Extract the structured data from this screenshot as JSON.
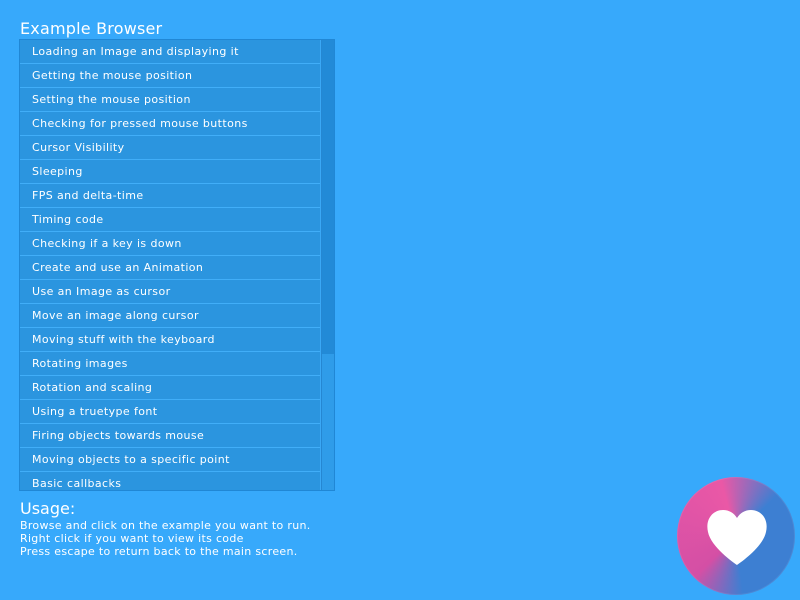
{
  "browser": {
    "title": "Example Browser"
  },
  "examples": [
    {
      "label": "Loading an Image and displaying it"
    },
    {
      "label": "Getting the mouse position"
    },
    {
      "label": "Setting the mouse position"
    },
    {
      "label": "Checking for pressed mouse buttons"
    },
    {
      "label": "Cursor Visibility"
    },
    {
      "label": "Sleeping"
    },
    {
      "label": "FPS and delta-time"
    },
    {
      "label": "Timing code"
    },
    {
      "label": "Checking if a key is down"
    },
    {
      "label": "Create and use an Animation"
    },
    {
      "label": "Use an Image as cursor"
    },
    {
      "label": "Move an image along cursor"
    },
    {
      "label": "Moving stuff with the keyboard"
    },
    {
      "label": "Rotating images"
    },
    {
      "label": "Rotation and scaling"
    },
    {
      "label": "Using a truetype font"
    },
    {
      "label": "Firing objects towards mouse"
    },
    {
      "label": "Moving objects to a specific point"
    },
    {
      "label": "Basic callbacks"
    }
  ],
  "usage": {
    "title": "Usage:",
    "lines": [
      "Browse and click on the example you want to run.",
      "Right click if you want to view its code",
      "Press escape to return back to the main screen."
    ]
  },
  "icons": {
    "logo": "heart-logo-icon"
  },
  "colors": {
    "background": "#37a9fb",
    "list_item": "#2b95df",
    "scrollbar_thumb": "#228ad7",
    "logo_pink": "#ea58a6",
    "logo_blue": "#3d7fd2"
  }
}
